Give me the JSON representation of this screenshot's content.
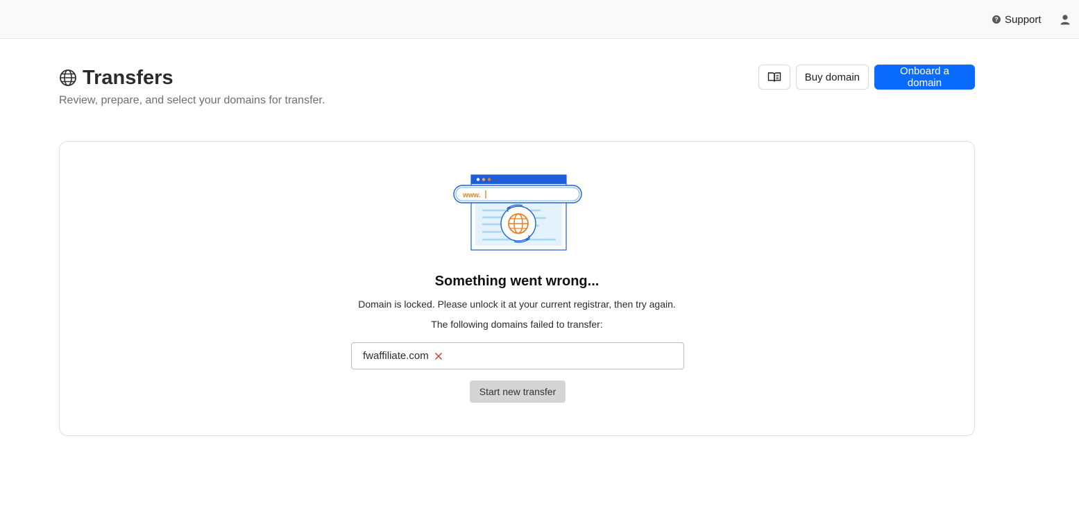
{
  "topbar": {
    "support_label": "Support",
    "support_icon": "?",
    "icons": {
      "support": "help-circle-icon",
      "user": "user-icon"
    }
  },
  "header": {
    "title": "Transfers",
    "subtitle": "Review, prepare, and select your domains for transfer.",
    "title_icon": "globe-icon",
    "docs_icon": "book-open-icon",
    "buy_label": "Buy domain",
    "onboard_label": "Onboard a domain"
  },
  "error_state": {
    "illustration_url_text": "www.",
    "title": "Something went wrong...",
    "message": "Domain is locked. Please unlock it at your current registrar, then try again.",
    "failed_label": "The following domains failed to transfer:",
    "failed_domains": [
      {
        "name": "fwaffiliate.com",
        "status_icon": "x-icon"
      }
    ],
    "start_label": "Start new transfer"
  },
  "colors": {
    "primary": "#0a6cff",
    "error_x": "#c0392b",
    "illustration_blue": "#1f5fd6",
    "illustration_orange": "#e87d1e",
    "disabled_button": "#d5d5d5"
  }
}
